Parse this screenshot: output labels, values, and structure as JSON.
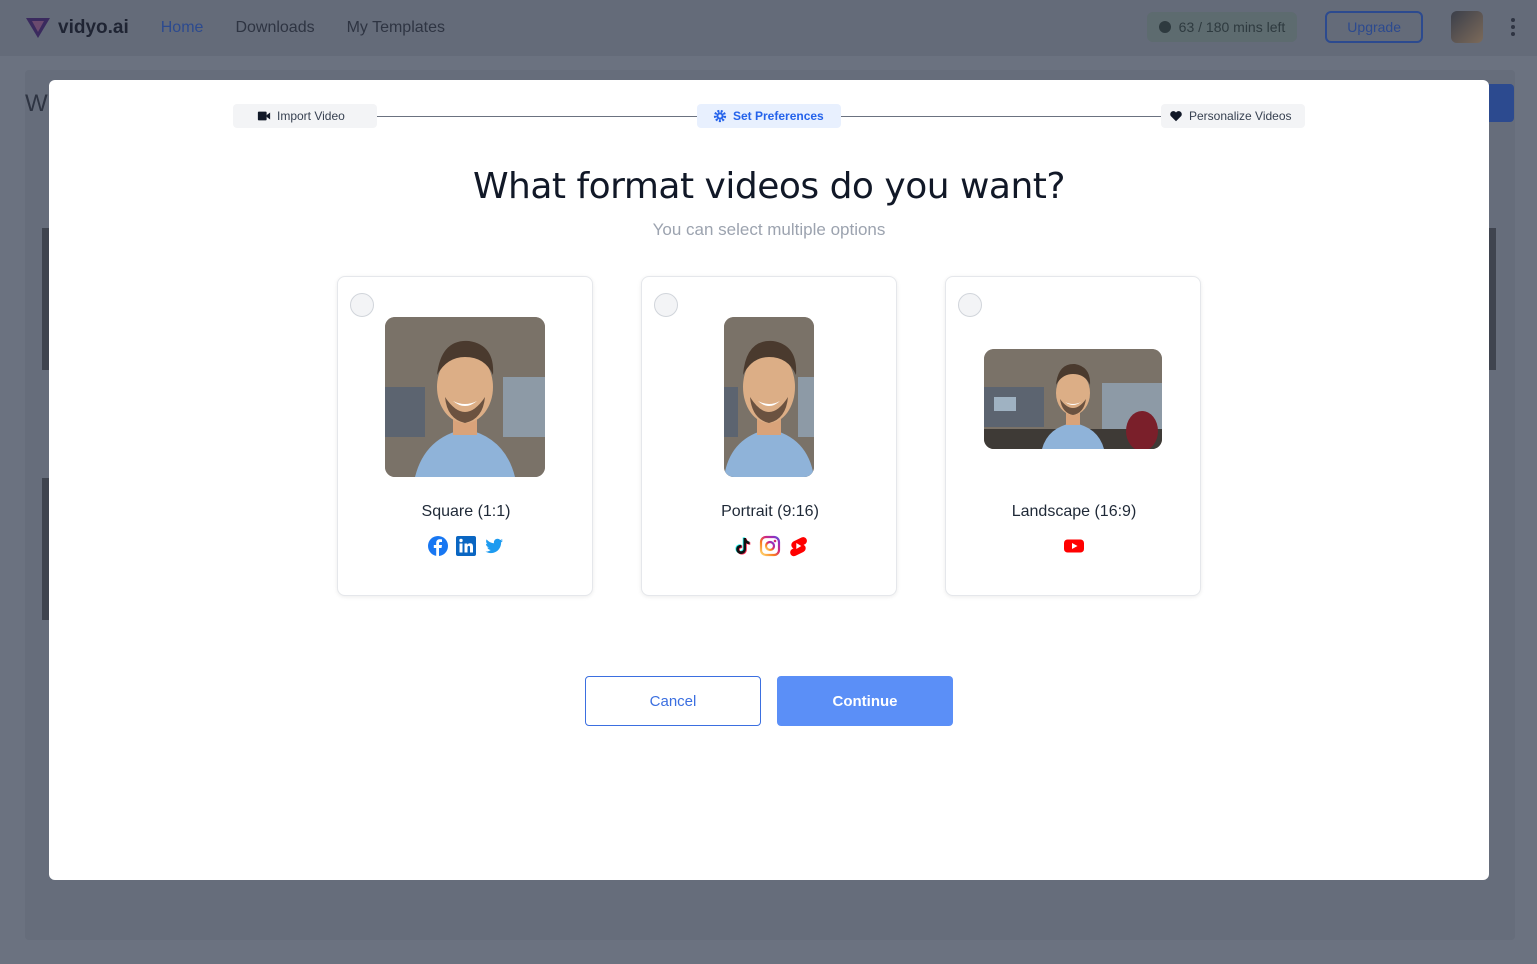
{
  "app": {
    "brand": "vidyo.ai",
    "nav": [
      "Home",
      "Downloads",
      "My Templates"
    ],
    "minutes_left": "63 / 180 mins left",
    "upgrade_label": "Upgrade",
    "bg_heading_initial": "W"
  },
  "colors": {
    "accent": "#5b8ff7",
    "accent_border": "#3b6fe0",
    "active_step_bg": "#e8f0fe",
    "active_step_text": "#2563eb",
    "youtube_red": "#ff0000",
    "facebook_blue": "#1877f2",
    "linkedin_blue": "#0a66c2",
    "twitter_blue": "#1d9bf0"
  },
  "stepper": {
    "steps": [
      {
        "label": "Import Video",
        "icon": "video-camera-icon",
        "active": false
      },
      {
        "label": "Set Preferences",
        "icon": "gear-icon",
        "active": true
      },
      {
        "label": "Personalize Videos",
        "icon": "heart-icon",
        "active": false
      }
    ]
  },
  "modal": {
    "title": "What format videos do you want?",
    "subtitle": "You can select multiple options",
    "formats": [
      {
        "label": "Square (1:1)",
        "selected": false,
        "platform_icons": [
          "facebook-icon",
          "linkedin-icon",
          "twitter-icon"
        ]
      },
      {
        "label": "Portrait (9:16)",
        "selected": false,
        "platform_icons": [
          "tiktok-icon",
          "instagram-icon",
          "youtube-shorts-icon"
        ]
      },
      {
        "label": "Landscape (16:9)",
        "selected": false,
        "platform_icons": [
          "youtube-icon"
        ]
      }
    ],
    "cancel_label": "Cancel",
    "continue_label": "Continue"
  }
}
